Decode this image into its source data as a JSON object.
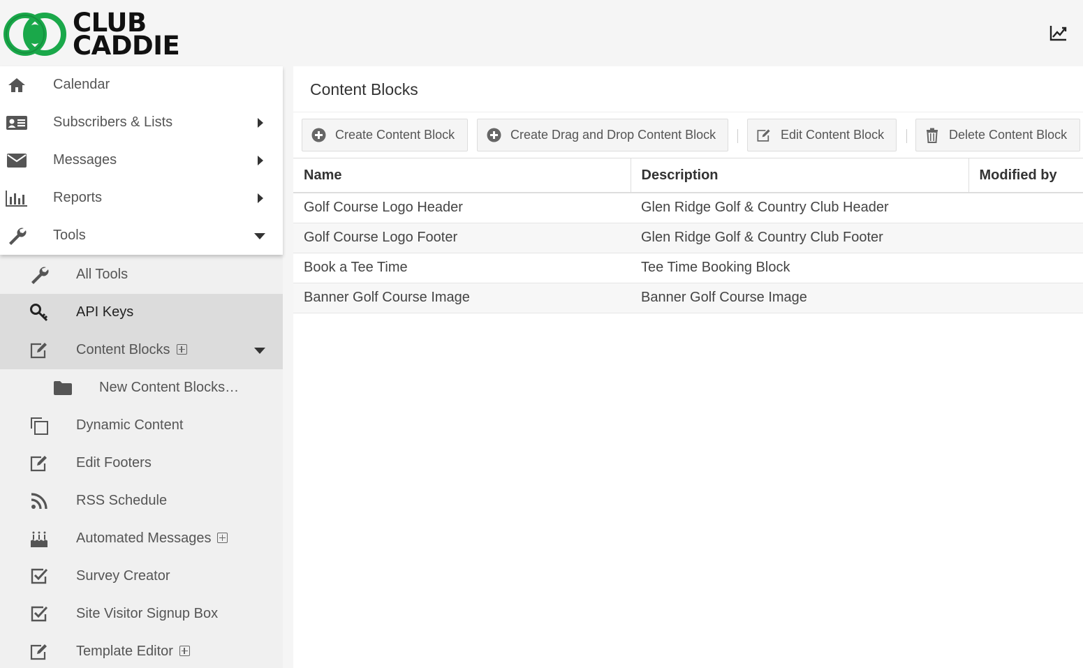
{
  "brand": {
    "line1": "CLUB",
    "line2": "CADDIE",
    "green": "#1aa84a"
  },
  "header": {
    "chart_icon": "line-chart-icon"
  },
  "nav": {
    "items": [
      {
        "label": "Calendar",
        "icon": "home-icon"
      },
      {
        "label": "Subscribers & Lists",
        "icon": "address-card-icon"
      },
      {
        "label": "Messages",
        "icon": "envelope-icon"
      },
      {
        "label": "Reports",
        "icon": "bar-chart-icon"
      },
      {
        "label": "Tools",
        "icon": "wrench-icon"
      }
    ],
    "tools": [
      {
        "label": "All Tools",
        "icon": "wrench-icon"
      },
      {
        "label": "API Keys",
        "icon": "key-icon"
      },
      {
        "label": "Content Blocks",
        "icon": "edit-icon"
      },
      {
        "label": "New Content Blocks…",
        "icon": "folder-icon"
      },
      {
        "label": "Dynamic Content",
        "icon": "copy-icon"
      },
      {
        "label": "Edit Footers",
        "icon": "edit-icon"
      },
      {
        "label": "RSS Schedule",
        "icon": "rss-icon"
      },
      {
        "label": "Automated Messages",
        "icon": "birthday-cake-icon"
      },
      {
        "label": "Survey Creator",
        "icon": "check-square-icon"
      },
      {
        "label": "Site Visitor Signup Box",
        "icon": "check-square-icon"
      },
      {
        "label": "Template Editor",
        "icon": "edit-icon"
      }
    ]
  },
  "main": {
    "title": "Content Blocks",
    "toolbar": {
      "create": "Create Content Block",
      "create_dnd": "Create Drag and Drop Content Block",
      "edit": "Edit Content Block",
      "delete": "Delete Content Block"
    },
    "table": {
      "headers": [
        "Name",
        "Description",
        "Modified by"
      ],
      "rows": [
        [
          "Golf Course Logo Header",
          "Glen Ridge Golf & Country Club Header",
          ""
        ],
        [
          "Golf Course Logo Footer",
          "Glen Ridge Golf & Country Club Footer",
          ""
        ],
        [
          "Book a Tee Time",
          "Tee Time Booking Block",
          ""
        ],
        [
          "Banner Golf Course Image",
          "Banner Golf Course Image",
          ""
        ]
      ]
    }
  }
}
